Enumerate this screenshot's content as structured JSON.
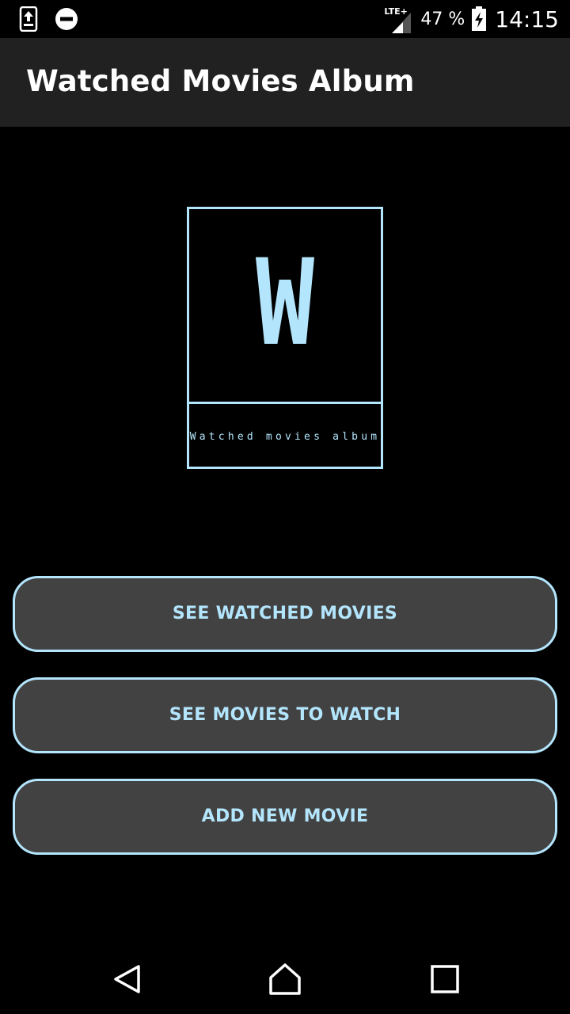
{
  "status_bar": {
    "battery_percent": "47 %",
    "time": "14:15",
    "network_type": "LTE+",
    "icons": [
      "upload-notification-icon",
      "do-not-disturb-icon",
      "signal-icon",
      "battery-charging-icon"
    ]
  },
  "app_bar": {
    "title": "Watched Movies Album"
  },
  "logo": {
    "letter": "W",
    "caption": "Watched movies album",
    "color": "#b3e5fc"
  },
  "buttons": {
    "see_watched": "SEE WATCHED MOVIES",
    "see_to_watch": "SEE MOVIES TO WATCH",
    "add_new": "ADD NEW MOVIE"
  },
  "navigation": {
    "icons": [
      "back-icon",
      "home-icon",
      "recents-icon"
    ]
  },
  "colors": {
    "accent": "#b3e5fc",
    "button_bg": "#424242",
    "app_bar_bg": "#212121",
    "background": "#000000"
  }
}
